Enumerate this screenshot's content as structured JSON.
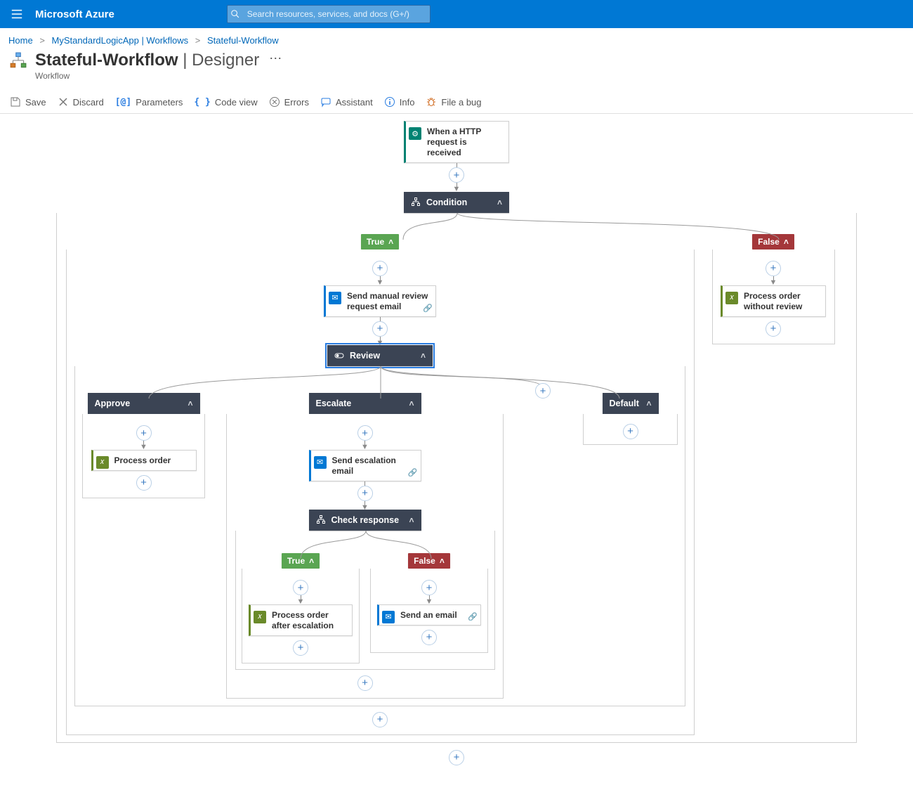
{
  "brand": "Microsoft Azure",
  "search": {
    "placeholder": "Search resources, services, and docs (G+/)"
  },
  "breadcrumb": [
    {
      "label": "Home"
    },
    {
      "label": "MyStandardLogicApp | Workflows"
    },
    {
      "label": "Stateful-Workflow"
    }
  ],
  "page": {
    "title": "Stateful-Workflow",
    "suffix": " | Designer",
    "subtitle": "Workflow"
  },
  "toolbar": {
    "save": "Save",
    "discard": "Discard",
    "parameters": "Parameters",
    "codeview": "Code view",
    "errors": "Errors",
    "assistant": "Assistant",
    "info": "Info",
    "bug": "File a bug"
  },
  "flow": {
    "trigger": {
      "label": "When a HTTP request is received"
    },
    "condition": {
      "label": "Condition"
    },
    "cond_true": {
      "badge": "True",
      "send_review": {
        "label": "Send manual review request email"
      },
      "review_switch": {
        "label": "Review"
      },
      "cases": {
        "approve": {
          "label": "Approve",
          "action": "Process order"
        },
        "escalate": {
          "label": "Escalate",
          "action": "Send escalation email",
          "check": {
            "label": "Check response",
            "true": {
              "badge": "True",
              "action": "Process order after escalation"
            },
            "false": {
              "badge": "False",
              "action": "Send an email"
            }
          }
        },
        "default": {
          "label": "Default"
        }
      }
    },
    "cond_false": {
      "badge": "False",
      "action": "Process order without review"
    }
  }
}
